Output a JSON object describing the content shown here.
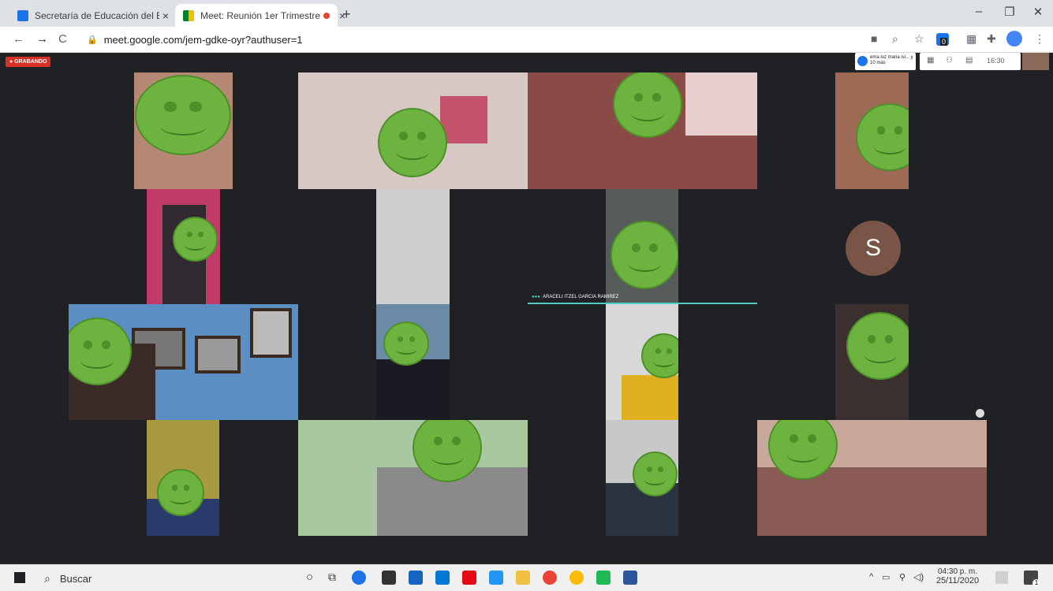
{
  "browser": {
    "tabs": [
      {
        "title": "Secretaría de Educación del Esta",
        "close": "×"
      },
      {
        "title": "Meet: Reunión 1er Trimestre",
        "close": "×"
      }
    ],
    "new_tab": "+",
    "window_controls": {
      "minimize": "–",
      "maximize": "❐",
      "close": "✕"
    },
    "nav": {
      "back": "←",
      "forward": "→",
      "reload": "C"
    },
    "url": "meet.google.com/jem-gdke-oyr?authuser=1",
    "toolbar_icons": [
      "camera-icon",
      "zoom-icon",
      "star-icon",
      "extension-badge-icon",
      "grid-icon",
      "puzzle-icon",
      "profile-icon",
      "menu-icon"
    ],
    "extension_badge": "0"
  },
  "meet": {
    "recording_label": "● GRABANDO",
    "participants_label": "ema luz maria isi... y 10 más",
    "time": "16:30",
    "speaker_name": "ARACELI ITZEL GARCIA RAMIREZ",
    "avatar_initial": "S"
  },
  "taskbar": {
    "search_placeholder": "Buscar",
    "clock_time": "04:30 p. m.",
    "clock_date": "25/11/2020",
    "notification_count": "1",
    "tray_caret": "^"
  },
  "colors": {
    "meet_bg": "#202124",
    "smiley": "#6db33f",
    "speaker_bar": "#4ecdc4",
    "recording": "#d93025"
  }
}
